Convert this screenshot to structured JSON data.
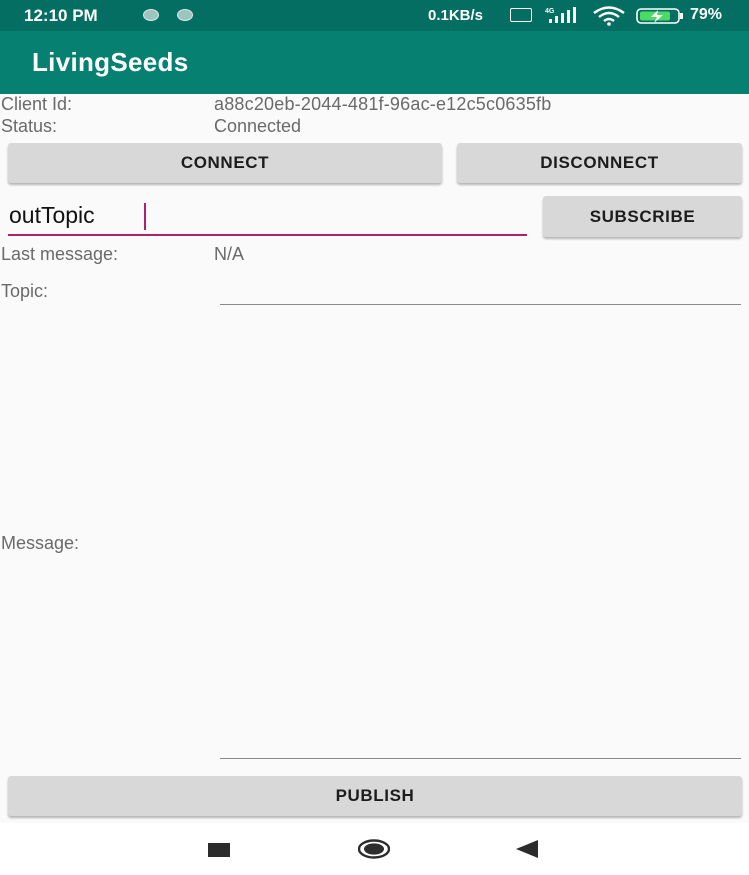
{
  "status_bar": {
    "time": "12:10 PM",
    "net_speed": "0.1KB/s",
    "battery_percent": "79%",
    "icons": [
      "notification-dot-icon",
      "notification-dot-icon",
      "volte-icon",
      "signal-4g-icon",
      "wifi-icon",
      "battery-charging-icon"
    ]
  },
  "app_bar": {
    "title": "LivingSeeds",
    "color": "#068071"
  },
  "client": {
    "id_label": "Client Id:",
    "id_value": "a88c20eb-2044-481f-96ac-e12c5c0635fb",
    "status_label": "Status:",
    "status_value": "Connected"
  },
  "buttons": {
    "connect": "CONNECT",
    "disconnect": "DISCONNECT",
    "subscribe": "SUBSCRIBE",
    "publish": "PUBLISH"
  },
  "subscribe_topic": {
    "value": "outTopic",
    "accent": "#b0216a"
  },
  "last_message": {
    "label": "Last message:",
    "value": "N/A"
  },
  "publish_form": {
    "topic_label": "Topic:",
    "topic_value": "",
    "message_label": "Message:",
    "message_value": ""
  },
  "nav_bar": {
    "icons": [
      "recents-icon",
      "home-icon",
      "back-icon"
    ]
  }
}
